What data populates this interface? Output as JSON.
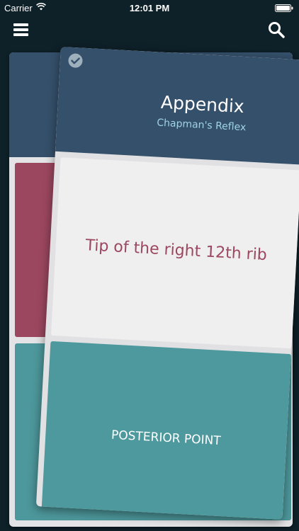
{
  "status_bar": {
    "carrier": "Carrier",
    "time": "12:01 PM",
    "wifi_icon": "wifi-icon",
    "battery_icon": "battery-icon"
  },
  "nav": {
    "menu_icon": "hamburger-menu-icon",
    "search_icon": "search-icon"
  },
  "card": {
    "title": "Appendix",
    "subtitle": "Chapman's Reflex",
    "check_icon": "checkmark-circle-icon",
    "answer": "Tip of the right 12th rib",
    "location": "POSTERIOR POINT"
  },
  "colors": {
    "background": "#0e2028",
    "card_header": "#35506b",
    "subtitle": "#9fd3e5",
    "answer_text": "#9c4760",
    "red_panel": "#9c4760",
    "teal_panel": "#4d999d",
    "card_body": "#efeff0"
  }
}
